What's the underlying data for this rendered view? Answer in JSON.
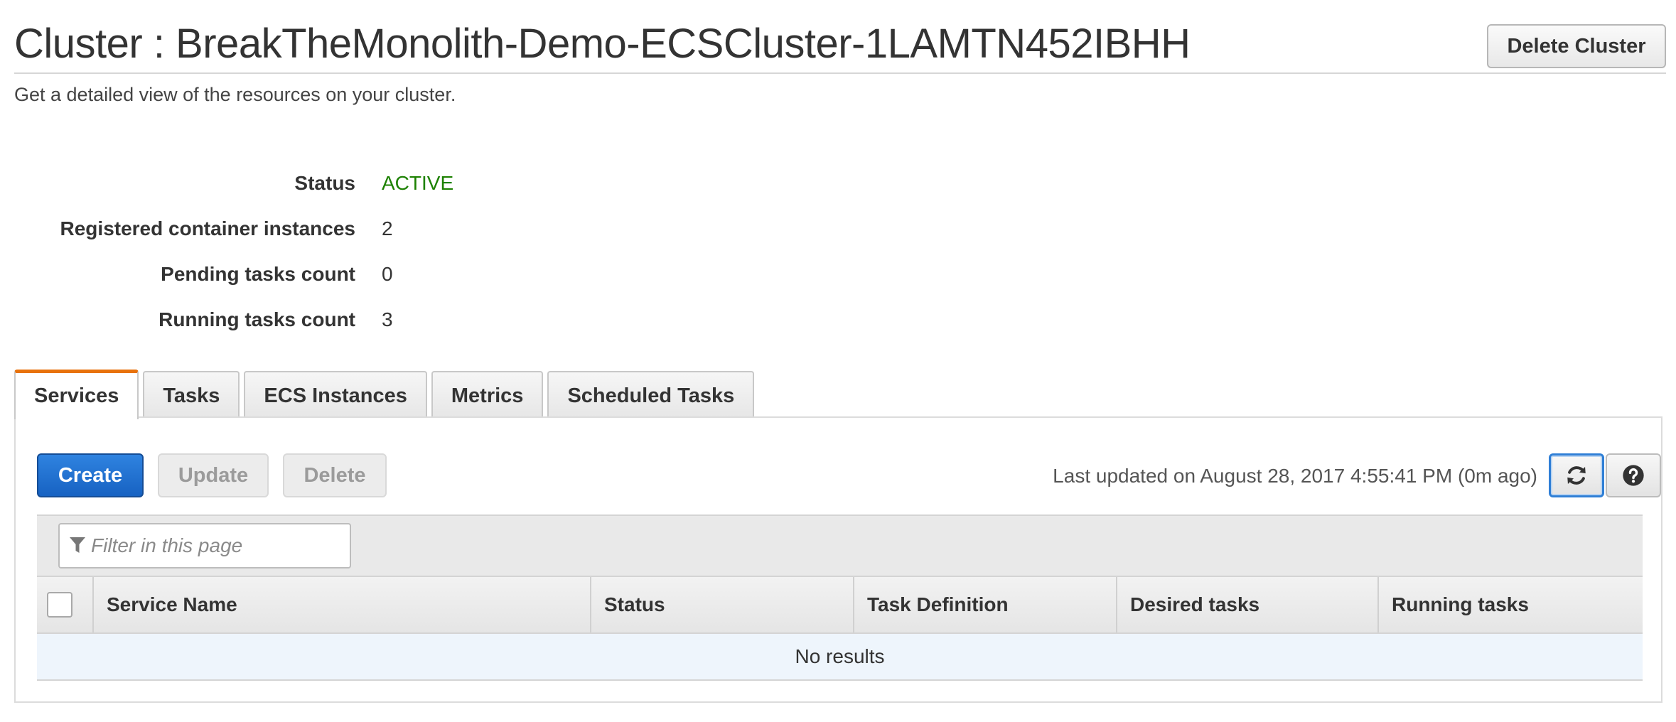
{
  "header": {
    "title": "Cluster : BreakTheMonolith-Demo-ECSCluster-1LAMTN452IBHH",
    "delete_cluster_label": "Delete Cluster",
    "subtitle": "Get a detailed view of the resources on your cluster."
  },
  "summary": {
    "status_label": "Status",
    "status_value": "ACTIVE",
    "registered_label": "Registered container instances",
    "registered_value": "2",
    "pending_label": "Pending tasks count",
    "pending_value": "0",
    "running_label": "Running tasks count",
    "running_value": "3"
  },
  "tabs": [
    {
      "label": "Services",
      "active": true
    },
    {
      "label": "Tasks",
      "active": false
    },
    {
      "label": "ECS Instances",
      "active": false
    },
    {
      "label": "Metrics",
      "active": false
    },
    {
      "label": "Scheduled Tasks",
      "active": false
    }
  ],
  "toolbar": {
    "create_label": "Create",
    "update_label": "Update",
    "delete_label": "Delete",
    "last_updated": "Last updated on August 28, 2017 4:55:41 PM (0m ago)",
    "refresh_icon": "refresh-icon",
    "help_icon": "help-icon"
  },
  "filter": {
    "placeholder": "Filter in this page",
    "icon": "filter-icon"
  },
  "table": {
    "columns": [
      "Service Name",
      "Status",
      "Task Definition",
      "Desired tasks",
      "Running tasks"
    ],
    "empty_text": "No results"
  },
  "colors": {
    "status_active": "#1d8102",
    "primary": "#1a6ad0",
    "active_tab_accent": "#e8720c",
    "empty_row_bg": "#eef5fc"
  }
}
